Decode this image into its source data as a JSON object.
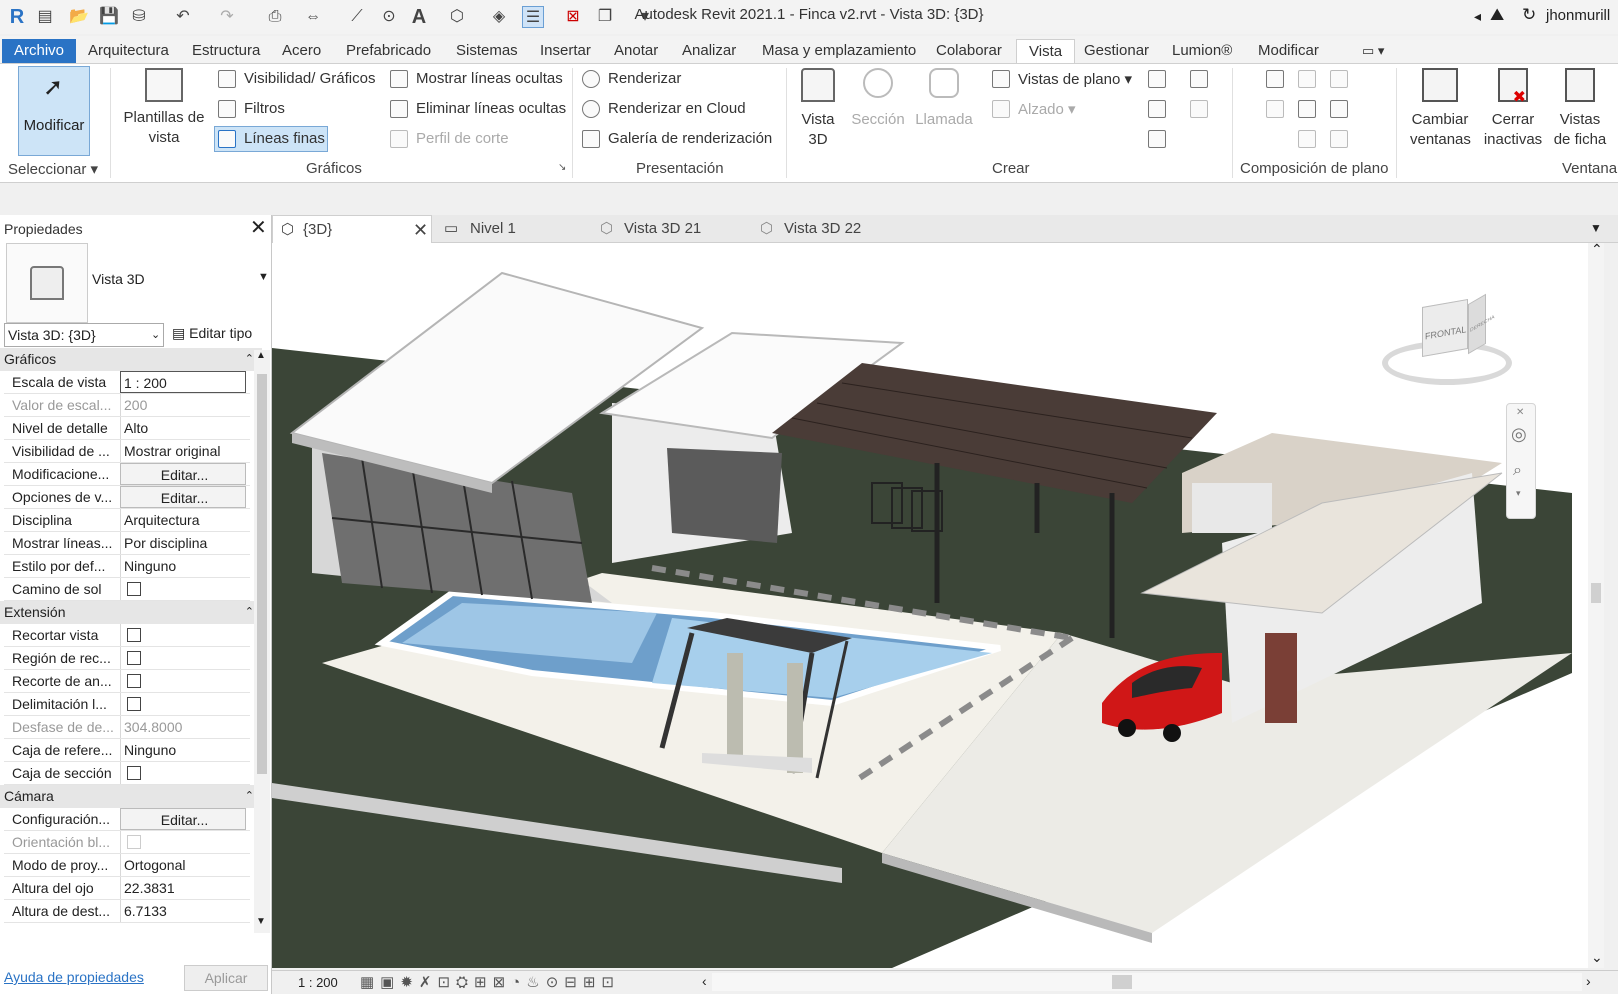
{
  "app": {
    "title": "Autodesk Revit 2021.1 - Finca v2.rvt - Vista 3D: {3D}",
    "user": "jhonmurill",
    "brand_color": "#2a73c5"
  },
  "quick_access": [
    "revit-logo-icon",
    "open-icon",
    "open-folder-icon",
    "save-icon",
    "sync-icon",
    "undo-icon",
    "redo-icon",
    "print-icon",
    "measure-icon",
    "dimension-icon",
    "tag-icon",
    "text-icon",
    "3d-view-icon",
    "section-icon",
    "thin-lines-icon",
    "close-hidden-icon",
    "switch-windows-icon",
    "customize-icon"
  ],
  "menu": [
    {
      "label": "Archivo"
    },
    {
      "label": "Arquitectura"
    },
    {
      "label": "Estructura"
    },
    {
      "label": "Acero"
    },
    {
      "label": "Prefabricado"
    },
    {
      "label": "Sistemas"
    },
    {
      "label": "Insertar"
    },
    {
      "label": "Anotar"
    },
    {
      "label": "Analizar"
    },
    {
      "label": "Masa y emplazamiento"
    },
    {
      "label": "Colaborar"
    },
    {
      "label": "Vista"
    },
    {
      "label": "Gestionar"
    },
    {
      "label": "Lumion®"
    },
    {
      "label": "Modificar"
    }
  ],
  "ribbon": {
    "select": {
      "modify": "Modificar",
      "group": "Seleccionar"
    },
    "graphics": {
      "templates": "Plantillas de vista",
      "visibility": "Visibilidad/ Gráficos",
      "filters": "Filtros",
      "thin_lines": "Líneas finas",
      "show_hidden": "Mostrar líneas ocultas",
      "remove_hidden": "Eliminar líneas ocultas",
      "cut_profile": "Perfil de corte",
      "group": "Gráficos"
    },
    "presentation": {
      "render": "Renderizar",
      "render_cloud": "Renderizar  en Cloud",
      "gallery": "Galería de  renderización",
      "group": "Presentación"
    },
    "create": {
      "view3d": "Vista 3D",
      "section": "Sección",
      "callout": "Llamada",
      "plan_views": "Vistas de plano",
      "elevation": "Alzado",
      "group": "Crear"
    },
    "sheet": {
      "group": "Composición de plano"
    },
    "windows": {
      "switch": "Cambiar ventanas",
      "close_inactive": "Cerrar inactivas",
      "tab_views": "Vistas de ficha",
      "group": "Ventana"
    }
  },
  "properties": {
    "title": "Propiedades",
    "type_name": "Vista 3D",
    "selector": "Vista 3D: {3D}",
    "edit_type": "Editar tipo",
    "groups": [
      {
        "name": "Gráficos",
        "rows": [
          {
            "label": "Escala de vista",
            "value": "1 : 200",
            "kind": "input"
          },
          {
            "label": "Valor de escal...",
            "value": "200",
            "kind": "disabled"
          },
          {
            "label": "Nivel de detalle",
            "value": "Alto",
            "kind": "text"
          },
          {
            "label": "Visibilidad de ...",
            "value": "Mostrar original",
            "kind": "text"
          },
          {
            "label": "Modificacione...",
            "value": "Editar...",
            "kind": "button"
          },
          {
            "label": "Opciones de v...",
            "value": "Editar...",
            "kind": "button"
          },
          {
            "label": "Disciplina",
            "value": "Arquitectura",
            "kind": "text"
          },
          {
            "label": "Mostrar líneas...",
            "value": "Por disciplina",
            "kind": "text"
          },
          {
            "label": "Estilo por def...",
            "value": "Ninguno",
            "kind": "text"
          },
          {
            "label": "Camino de sol",
            "value": "",
            "kind": "check"
          }
        ]
      },
      {
        "name": "Extensión",
        "rows": [
          {
            "label": "Recortar vista",
            "value": "",
            "kind": "check"
          },
          {
            "label": "Región de rec...",
            "value": "",
            "kind": "check"
          },
          {
            "label": "Recorte de an...",
            "value": "",
            "kind": "check"
          },
          {
            "label": "Delimitación l...",
            "value": "",
            "kind": "check"
          },
          {
            "label": "Desfase de de...",
            "value": "304.8000",
            "kind": "disabled"
          },
          {
            "label": "Caja de refere...",
            "value": "Ninguno",
            "kind": "text"
          },
          {
            "label": "Caja de sección",
            "value": "",
            "kind": "check"
          }
        ]
      },
      {
        "name": "Cámara",
        "rows": [
          {
            "label": "Configuración...",
            "value": "Editar...",
            "kind": "button"
          },
          {
            "label": "Orientación bl...",
            "value": "",
            "kind": "checkdis"
          },
          {
            "label": "Modo de proy...",
            "value": "Ortogonal",
            "kind": "text"
          },
          {
            "label": "Altura del ojo",
            "value": "22.3831",
            "kind": "text"
          },
          {
            "label": "Altura de dest...",
            "value": "6.7133",
            "kind": "text"
          }
        ]
      }
    ],
    "help": "Ayuda de propiedades",
    "apply": "Aplicar"
  },
  "view_tabs": [
    {
      "label": "{3D}",
      "active": true
    },
    {
      "label": "Nivel 1",
      "active": false
    },
    {
      "label": "Vista 3D 21",
      "active": false
    },
    {
      "label": "Vista 3D 22",
      "active": false
    }
  ],
  "viewcube": {
    "face": "FRONTAL",
    "side": "DERECHA"
  },
  "status": {
    "scale": "1 : 200"
  }
}
